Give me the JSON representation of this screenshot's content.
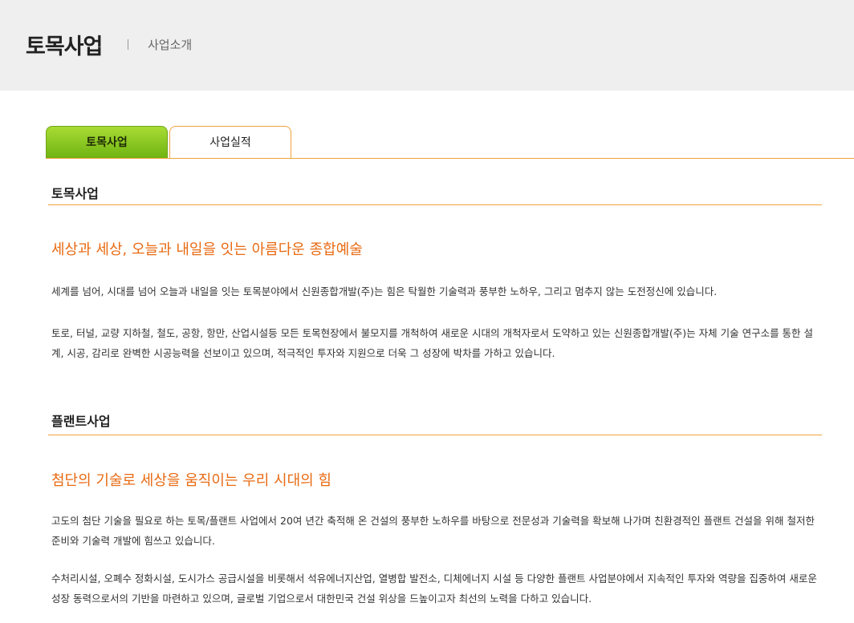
{
  "header": {
    "title": "토목사업",
    "subtitle": "사업소개"
  },
  "tabs": [
    {
      "label": "토목사업"
    },
    {
      "label": "사업실적"
    }
  ],
  "sections": [
    {
      "title": "토목사업",
      "headline": "세상과 세상, 오늘과 내일을 잇는 아름다운 종합예술",
      "paragraphs": [
        "세계를 넘어, 시대를 넘어 오늘과 내일을 잇는 토목분야에서 신원종합개발(주)는 힘은 탁월한 기술력과 풍부한 노하우, 그리고 멈추지 않는 도전정신에 있습니다.",
        "토로, 터널, 교량 지하철, 철도, 공항, 항만, 산업시설등 모든 토목현장에서 불모지를 개척하여 새로운 시대의 개척자로서 도약하고 있는 신원종합개발(주)는 자체 기술 연구소를 통한 설계, 시공, 감리로 완벽한 시공능력을 선보이고 있으며, 적극적인 투자와 지원으로 더욱 그 성장에 박차를 가하고 있습니다."
      ]
    },
    {
      "title": "플랜트사업",
      "headline": "첨단의 기술로 세상을 움직이는 우리 시대의 힘",
      "paragraphs": [
        "고도의 첨단 기술을 필요로 하는 토목/플랜트 사업에서 20여 년간 축적해 온 건설의 풍부한 노하우를 바탕으로 전문성과 기술력을 확보해 나가며 친환경적인 플랜트 건설을 위해 철저한 준비와 기술력 개발에 힘쓰고 있습니다.",
        "수처리시설, 오폐수 정화시설, 도시가스 공급시설을 비롯해서 석유에너지산업, 열병합 발전소, 디체에너지 시설 등 다양한 플랜트 사업분야에서 지속적인 투자와 역량을 집중하여 새로운 성장 동력으로서의 기반을 마련하고 있으며, 글로벌 기업으로서 대한민국 건설 위상을 드높이고자 최선의 노력을 다하고 있습니다."
      ]
    }
  ]
}
